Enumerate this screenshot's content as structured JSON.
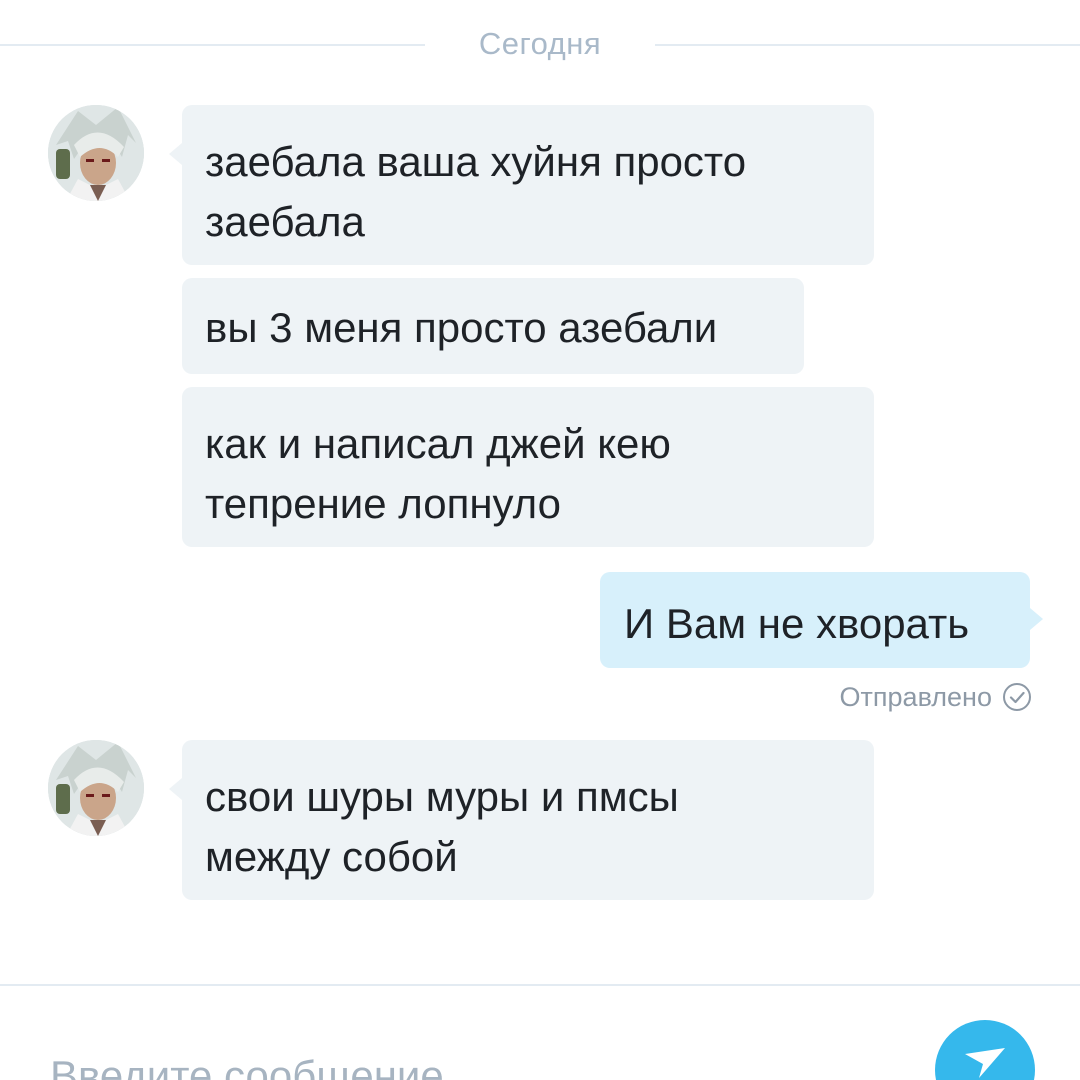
{
  "chat": {
    "date_divider": "Сегодня",
    "messages": [
      {
        "direction": "incoming",
        "text": "заебала ваша хуйня просто\nзаебала"
      },
      {
        "direction": "incoming",
        "text": "вы 3 меня просто азебали"
      },
      {
        "direction": "incoming",
        "text": "как и написал джей кею\nтепрение лопнуло"
      },
      {
        "direction": "outgoing",
        "text": "И Вам не хворать"
      },
      {
        "direction": "incoming",
        "text": "свои шуры муры и пмсы\nмежду собой"
      }
    ],
    "sent_status": "Отправлено"
  },
  "composer": {
    "placeholder": "Введите сообщение"
  },
  "icons": {
    "avatar": "user-avatar-anime-character",
    "status": "check-circle-icon",
    "send": "send-icon"
  },
  "colors": {
    "incoming_bubble": "#eef3f6",
    "outgoing_bubble": "#d7f0fb",
    "send_button": "#35b8ec",
    "divider_text": "#a9b9c9"
  }
}
